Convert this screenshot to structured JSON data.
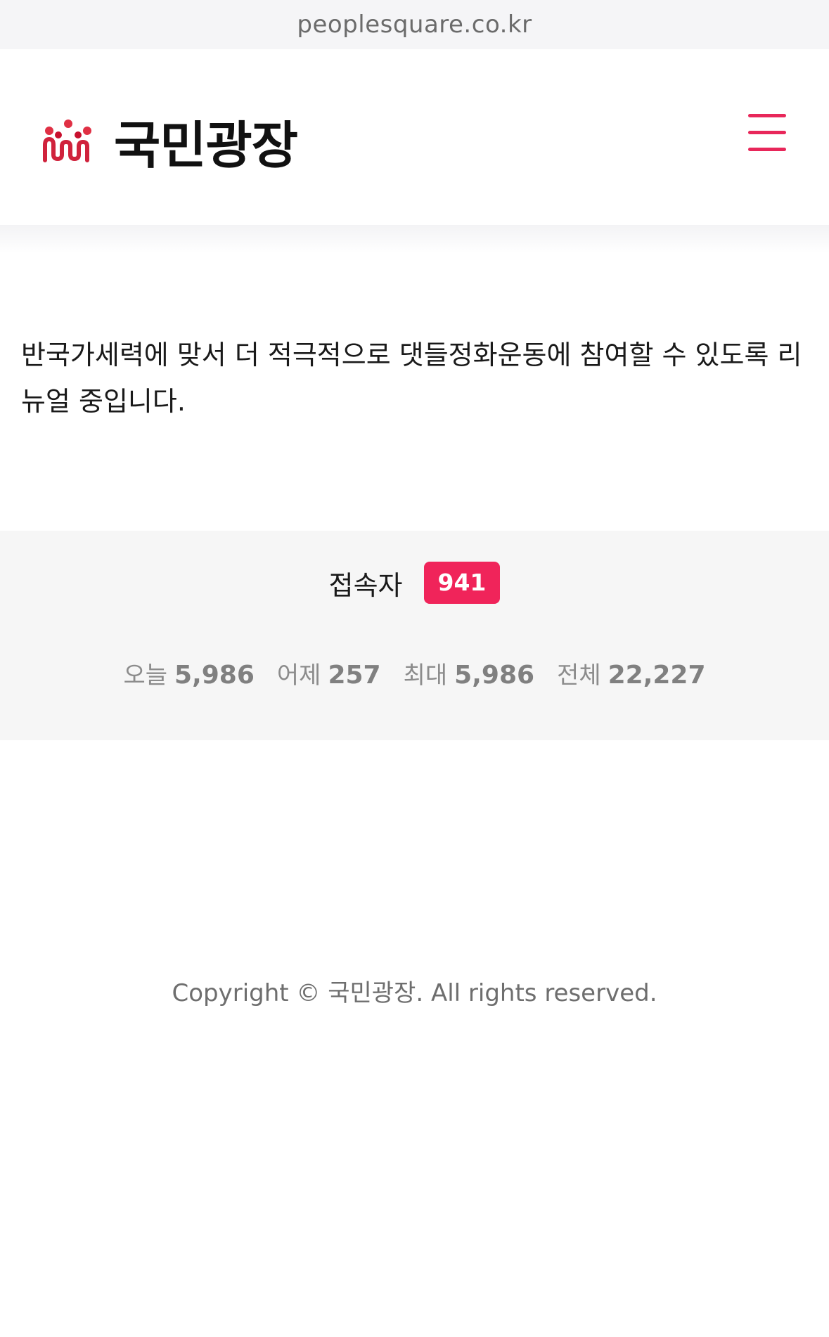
{
  "browser": {
    "url": "peoplesquare.co.kr"
  },
  "header": {
    "logo_text": "국민광장",
    "logo_icon": "people-logo-icon",
    "menu_icon": "hamburger-menu-icon",
    "accent_color": "#e8275a"
  },
  "main": {
    "notice": "반국가세력에 맞서 더 적극적으로 댓들정화운동에 참여할 수 있도록 리뉴얼 중입니다."
  },
  "stats": {
    "visitors_label": "접속자",
    "visitors_count": "941",
    "counts": [
      {
        "label": "오늘",
        "value": "5,986"
      },
      {
        "label": "어제",
        "value": "257"
      },
      {
        "label": "최대",
        "value": "5,986"
      },
      {
        "label": "전체",
        "value": "22,227"
      }
    ]
  },
  "footer": {
    "copyright": "Copyright © 국민광장. All rights reserved."
  }
}
